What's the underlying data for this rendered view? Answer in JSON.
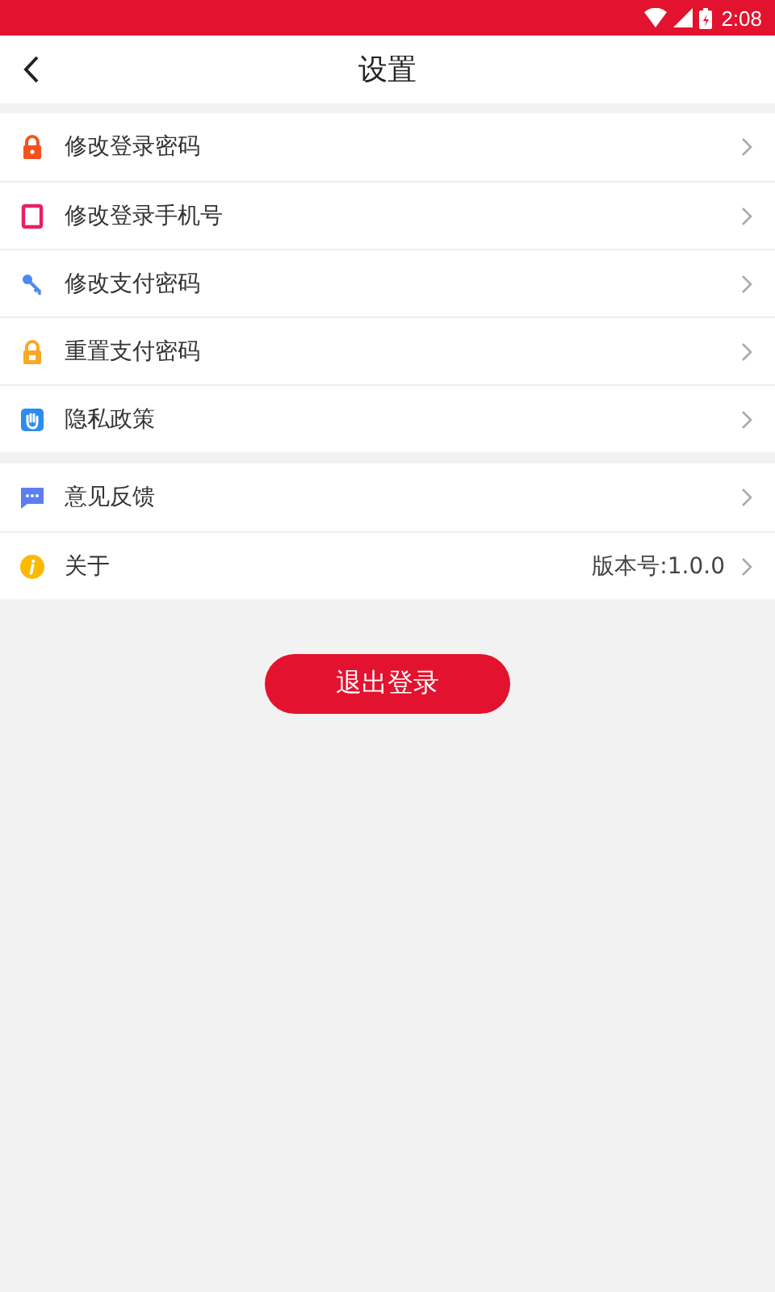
{
  "status_bar": {
    "time": "2:08"
  },
  "header": {
    "title": "设置"
  },
  "groups": [
    {
      "items": [
        {
          "label": "修改登录密码"
        },
        {
          "label": "修改登录手机号"
        },
        {
          "label": "修改支付密码"
        },
        {
          "label": "重置支付密码"
        },
        {
          "label": "隐私政策"
        }
      ]
    },
    {
      "items": [
        {
          "label": "意见反馈"
        },
        {
          "label": "关于",
          "value": "版本号:1.0.0"
        }
      ]
    }
  ],
  "logout_button": {
    "label": "退出登录"
  }
}
